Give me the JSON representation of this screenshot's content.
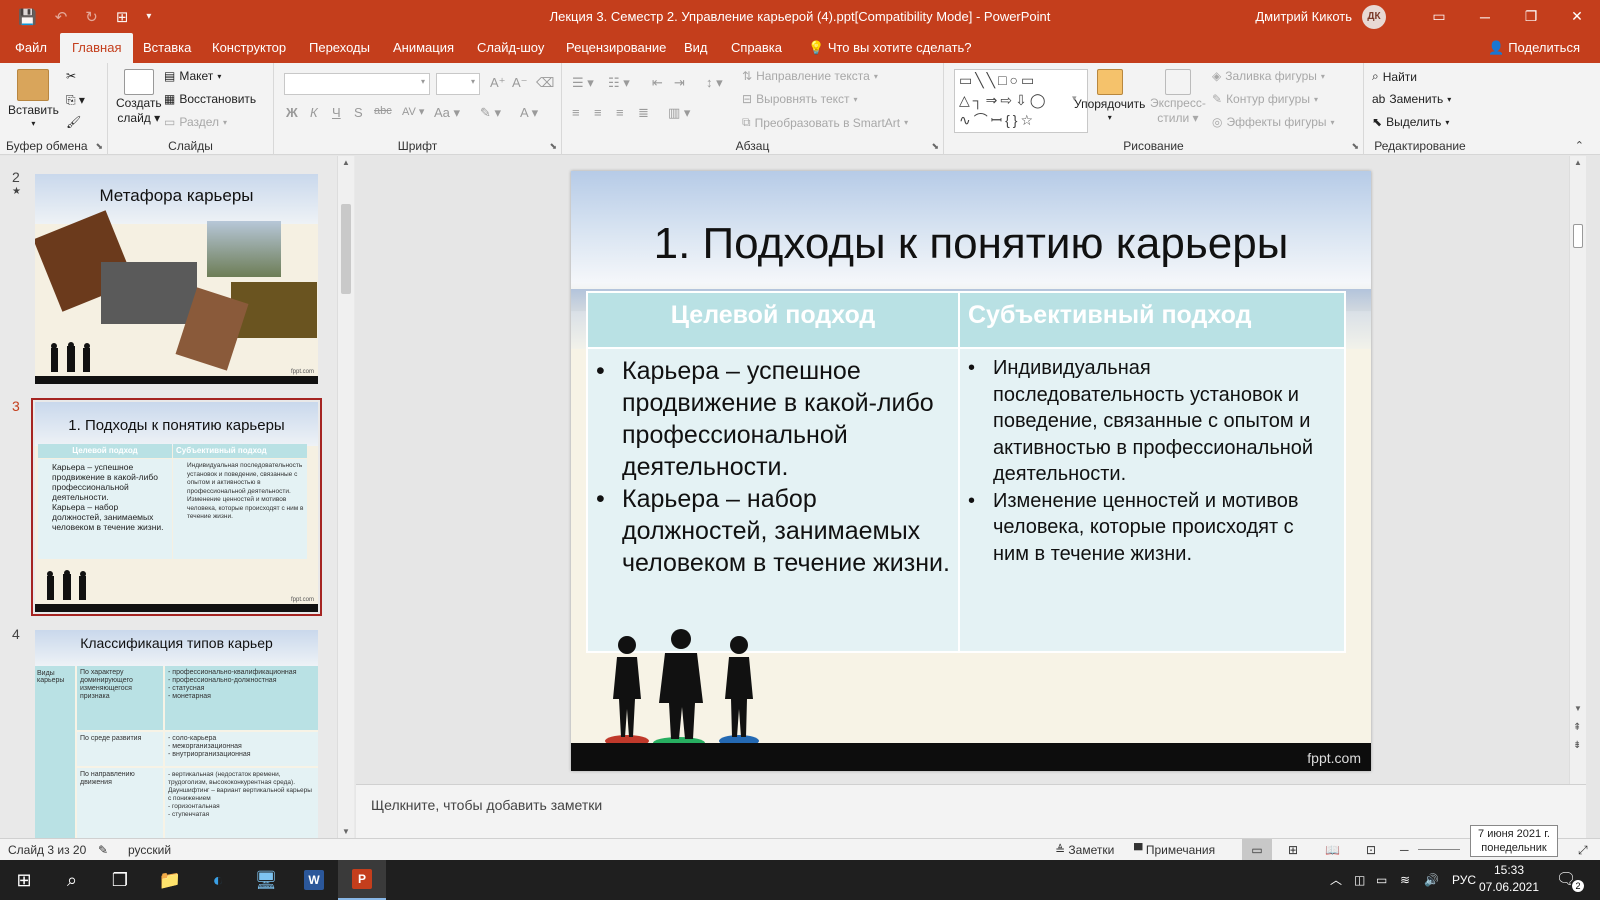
{
  "titlebar": {
    "doc_title": "Лекция 3. Семестр 2. Управление карьерой (4).ppt[Compatibility Mode]  -  PowerPoint",
    "user_name": "Дмитрий Кикоть",
    "avatar_initials": "ДК"
  },
  "tabs": [
    {
      "label": "Файл"
    },
    {
      "label": "Главная"
    },
    {
      "label": "Вставка"
    },
    {
      "label": "Конструктор"
    },
    {
      "label": "Переходы"
    },
    {
      "label": "Анимация"
    },
    {
      "label": "Слайд-шоу"
    },
    {
      "label": "Рецензирование"
    },
    {
      "label": "Вид"
    },
    {
      "label": "Справка"
    }
  ],
  "tell_me": "Что вы хотите сделать?",
  "share_label": "Поделиться",
  "ribbon": {
    "clipboard": {
      "label": "Буфер обмена",
      "paste": "Вставить"
    },
    "slides": {
      "label": "Слайды",
      "new_slide_line1": "Создать",
      "new_slide_line2": "слайд",
      "layout": "Макет",
      "reset": "Восстановить",
      "section": "Раздел"
    },
    "font": {
      "label": "Шрифт"
    },
    "paragraph": {
      "label": "Абзац",
      "text_direction": "Направление текста",
      "align_text": "Выровнять текст",
      "smartart": "Преобразовать в SmartArt"
    },
    "drawing": {
      "label": "Рисование",
      "arrange": "Упорядочить",
      "quick_styles_line1": "Экспресс-",
      "quick_styles_line2": "стили",
      "shape_fill": "Заливка фигуры",
      "shape_outline": "Контур фигуры",
      "shape_effects": "Эффекты фигуры"
    },
    "editing": {
      "label": "Редактирование",
      "find": "Найти",
      "replace": "Заменить",
      "select": "Выделить"
    }
  },
  "thumbnails": [
    {
      "number": "2",
      "star": "★",
      "title": "Метафора карьеры",
      "footer": "fppt.com"
    },
    {
      "number": "3",
      "title": "1. Подходы к понятию карьеры",
      "col1": "Целевой подход",
      "col2": "Субъективный подход",
      "left_items": [
        "Карьера – успешное продвижение в какой-либо профессиональной деятельности.",
        "Карьера – набор должностей, занимаемых человеком в течение жизни."
      ],
      "right_items": [
        "Индивидуальная последовательность установок и поведение, связанные с опытом и активностью в профессиональной деятельности.",
        "Изменение ценностей и мотивов человека, которые происходят с ним в течение жизни."
      ],
      "footer": "fppt.com"
    },
    {
      "number": "4",
      "title": "Классификация типов карьер",
      "side": "Виды карьеры",
      "rows": [
        {
          "criterion": "По характеру доминирующего изменяющегося признака",
          "types": "- профессионально-квалификационная\n- профессионально-должностная\n- статусная\n- монетарная"
        },
        {
          "criterion": "По среде развития",
          "types": "- соло-карьера\n- межорганизационная\n- внутриорганизационная"
        },
        {
          "criterion": "По направлению движения",
          "types": "- вертикальная (недостаток времени, трудоголизм, высококонкурентная среда). Дауншифтинг – вариант вертикальной карьеры с понижением\n- горизонтальная\n- ступенчатая"
        }
      ]
    }
  ],
  "slide": {
    "title": "1. Подходы к понятию карьеры",
    "col1_header": "Целевой подход",
    "col2_header": "Субъективный подход",
    "left_items": [
      "Карьера – успешное продвижение в какой-либо профессиональной деятельности.",
      "Карьера – набор должностей, занимаемых человеком в течение жизни."
    ],
    "right_items": [
      "Индивидуальная последовательность установок и поведение, связанные с опытом и активностью в профессиональной деятельности.",
      "Изменение ценностей и мотивов человека, которые происходят с ним в течение жизни."
    ],
    "footer": "fppt.com"
  },
  "notes_placeholder": "Щелкните, чтобы добавить заметки",
  "statusbar": {
    "slide_count": "Слайд 3 из 20",
    "language": "русский",
    "notes": "Заметки",
    "comments": "Примечания",
    "zoom_suffix": "%"
  },
  "tooltip": {
    "line1": "7 июня 2021 г.",
    "line2": "понедельник"
  },
  "taskbar": {
    "time": "15:33",
    "date": "07.06.2021",
    "lang": "РУС",
    "notif_count": "2",
    "apps": [
      "windows-icon",
      "search-icon",
      "task-view-icon",
      "explorer-icon",
      "edge-icon",
      "remote-desktop-icon",
      "word-icon",
      "powerpoint-icon"
    ]
  },
  "colors": {
    "accent": "#c43e1c",
    "selection": "#a52422",
    "table_header": "#b9e1e4",
    "table_body": "#e4f2f4"
  }
}
